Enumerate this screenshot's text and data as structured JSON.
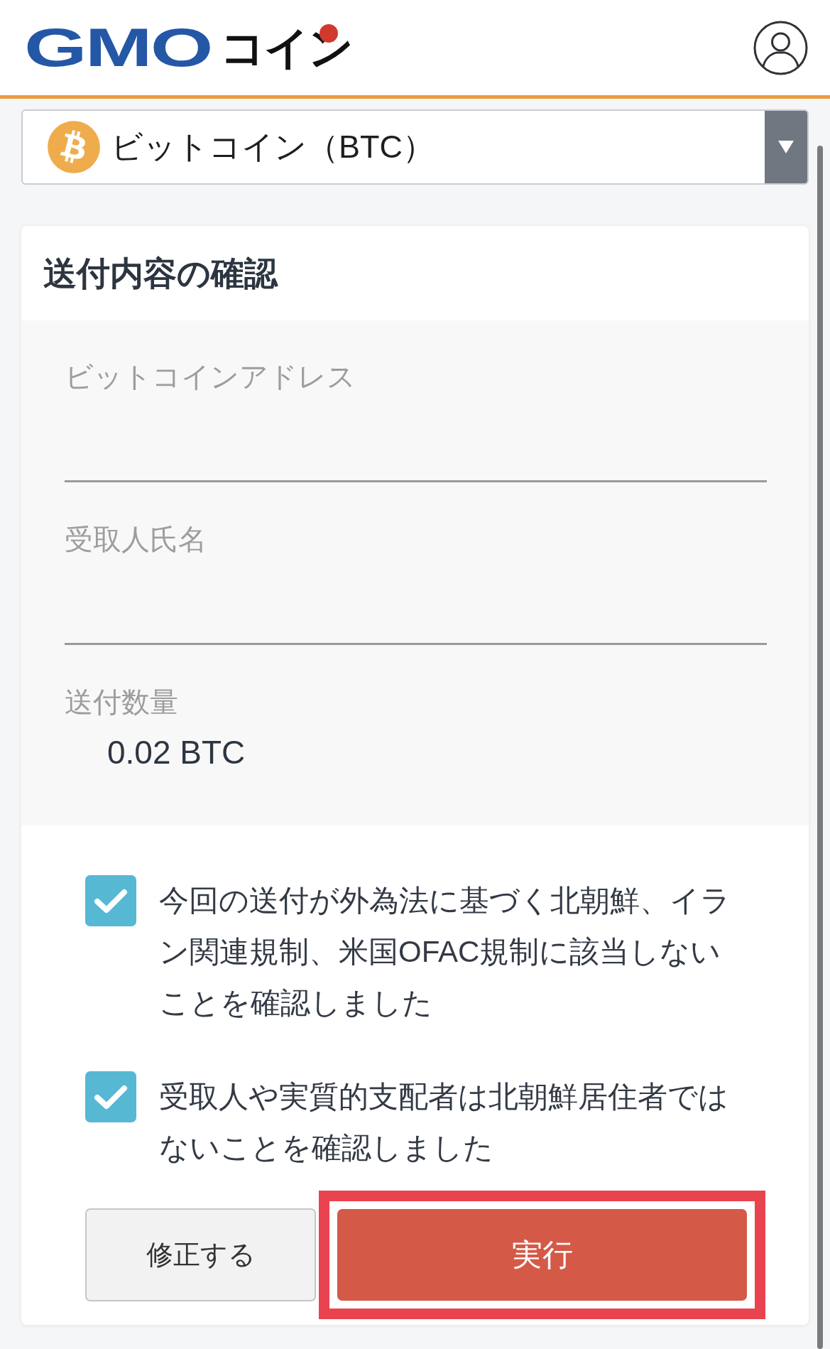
{
  "header": {
    "logo": {
      "brand": "GMO",
      "product": "コイン"
    }
  },
  "currency_select": {
    "value": "ビットコイン（BTC）"
  },
  "card": {
    "title": "送付内容の確認",
    "fields": [
      {
        "kind": "input",
        "label": "ビットコインアドレス"
      },
      {
        "kind": "input",
        "label": "受取人氏名"
      },
      {
        "kind": "static",
        "label": "送付数量",
        "value": "0.02 BTC"
      }
    ],
    "confirmations": [
      {
        "text": "今回の送付が外為法に基づく北朝鮮、イラン関連規制、米国OFAC規制に該当しないことを確認しました",
        "checked": true
      },
      {
        "text": "受取人や実質的支配者は北朝鮮居住者ではないことを確認しました",
        "checked": true
      }
    ],
    "buttons": [
      {
        "kind": "secondary",
        "label": "修正する",
        "highlighted": false
      },
      {
        "kind": "primary",
        "label": "実行",
        "highlighted": true
      }
    ]
  }
}
